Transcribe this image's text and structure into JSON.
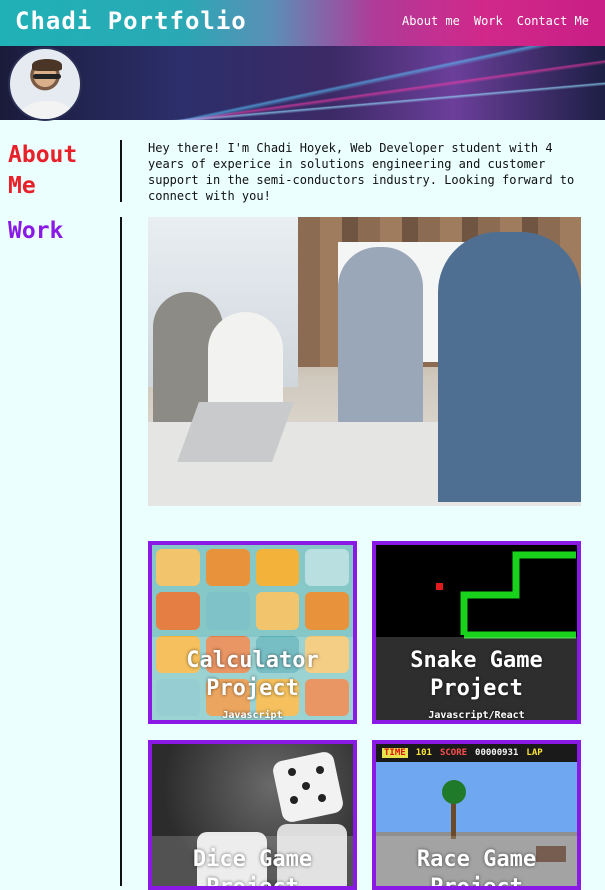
{
  "header": {
    "title": "Chadi Portfolio",
    "nav": [
      "About me",
      "Work",
      "Contact Me"
    ]
  },
  "sidebar": {
    "about_label": "About Me",
    "work_label": "Work"
  },
  "about": {
    "text": "Hey there! I'm Chadi Hoyek, Web Developer student with 4 years of experice in solutions engineering and customer support in the semi-conductors industry. Looking forward to connect with you!"
  },
  "projects": [
    {
      "title": "Calculator Project",
      "tech": "Javascript"
    },
    {
      "title": "Snake Game Project",
      "tech": "Javascript/React"
    },
    {
      "title": "Dice Game Project",
      "tech": ""
    },
    {
      "title": "Race Game Project",
      "tech": ""
    }
  ],
  "race_hud": {
    "time": "TIME",
    "speed": "101",
    "score_label": "SCORE",
    "score": "00000931",
    "lap": "LAP"
  },
  "colors": {
    "accent": "#8a19e6",
    "about_red": "#e8202a",
    "background": "#eafffe"
  }
}
